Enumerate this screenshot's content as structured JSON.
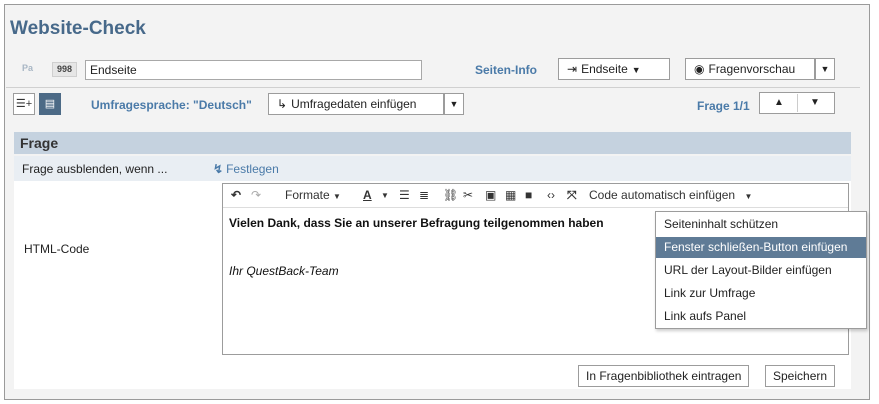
{
  "page": {
    "title": "Website-Check"
  },
  "page_info": {
    "page_label": "Pa",
    "page_number": "998",
    "page_name_value": "Endseite",
    "seiten_info_label": "Seiten-Info",
    "jump_button_label": "Endseite",
    "preview_button_label": "Fragenvorschau"
  },
  "language_bar": {
    "language_label": "Umfragesprache: \"Deutsch\"",
    "insert_survey_data_label": "Umfragedaten einfügen",
    "question_counter": "Frage 1/1"
  },
  "section": {
    "heading": "Frage",
    "hide_label": "Frage ausblenden, wenn ...",
    "festlegen_label": "Festlegen",
    "html_code_label": "HTML-Code"
  },
  "toolbar": {
    "formats_label": "Formate",
    "code_insert_label": "Code automatisch einfügen"
  },
  "editor": {
    "line1": "Vielen Dank, dass Sie an unserer Befragung teilgenommen haben",
    "line2": "Ihr QuestBack-Team"
  },
  "code_menu": {
    "items": [
      "Seiteninhalt schützen",
      "Fenster schließen-Button einfügen",
      "URL der Layout-Bilder einfügen",
      "Link zur Umfrage",
      "Link aufs Panel"
    ],
    "active_index": 1
  },
  "footer": {
    "library_button_label": "In Fragenbibliothek eintragen",
    "save_button_label": "Speichern"
  },
  "colors": {
    "title": "#47698a",
    "link": "#4a7aa8",
    "section_header": "#c5d2df",
    "menu_active": "#5f7b96"
  }
}
